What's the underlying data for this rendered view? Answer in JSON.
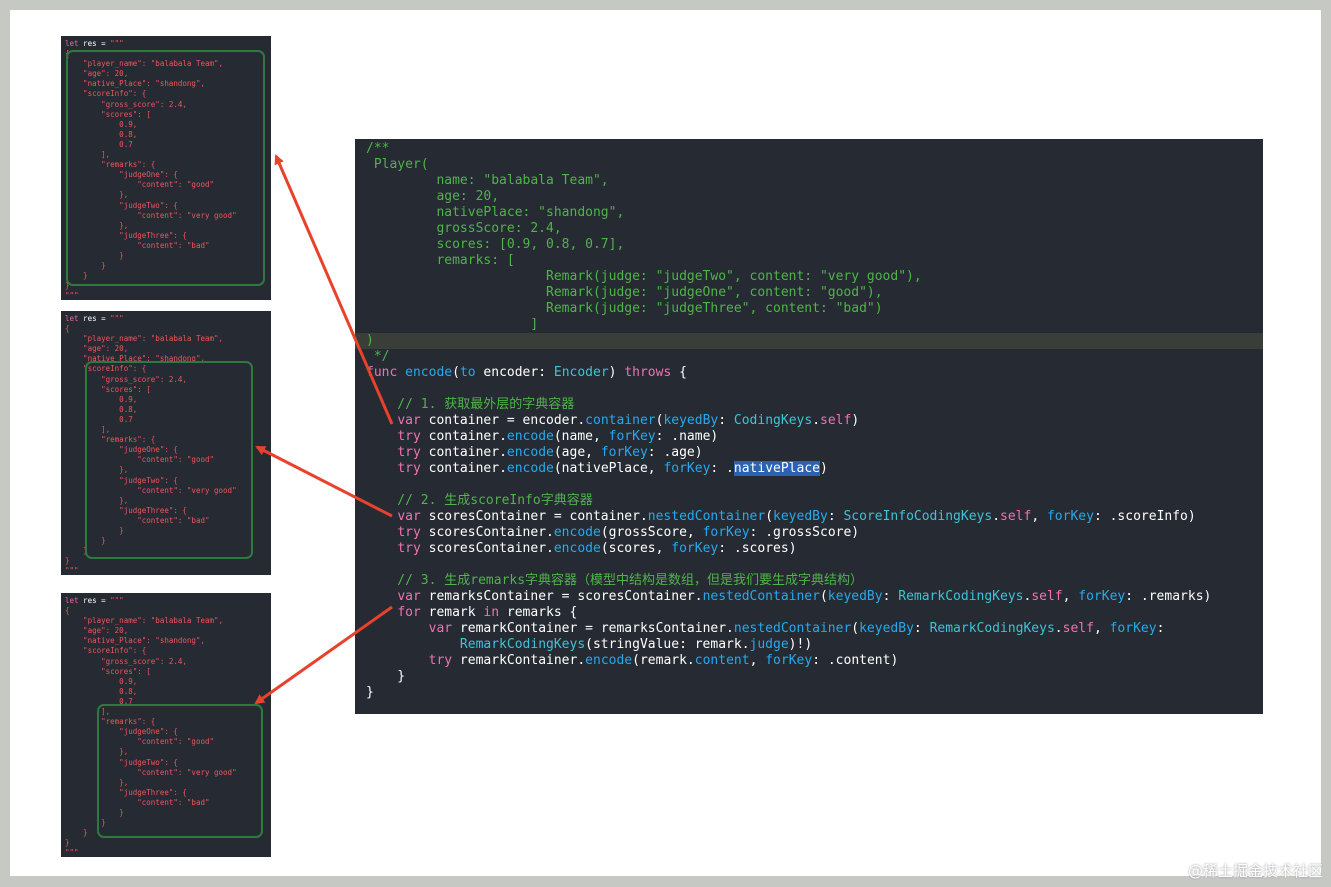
{
  "thumbnails": [
    {
      "lines": [
        "let res = \"\"\"",
        "{",
        "    \"player_name\": \"balabala Team\",",
        "    \"age\": 20,",
        "    \"native_Place\": \"shandong\",",
        "    \"scoreInfo\": {",
        "        \"gross_score\": 2.4,",
        "        \"scores\": [",
        "            0.9,",
        "            0.8,",
        "            0.7",
        "        ],",
        "        \"remarks\": {",
        "            \"judgeOne\": {",
        "                \"content\": \"good\"",
        "            },",
        "            \"judgeTwo\": {",
        "                \"content\": \"very good\"",
        "            },",
        "            \"judgeThree\": {",
        "                \"content\": \"bad\"",
        "            }",
        "        }",
        "    }",
        "}",
        "\"\"\""
      ]
    },
    {
      "lines": [
        "let res = \"\"\"",
        "{",
        "    \"player_name\": \"balabala Team\",",
        "    \"age\": 20,",
        "    \"native_Place\": \"shandong\",",
        "    \"scoreInfo\": {",
        "        \"gross_score\": 2.4,",
        "        \"scores\": [",
        "            0.9,",
        "            0.8,",
        "            0.7",
        "        ],",
        "        \"remarks\": {",
        "            \"judgeOne\": {",
        "                \"content\": \"good\"",
        "            },",
        "            \"judgeTwo\": {",
        "                \"content\": \"very good\"",
        "            },",
        "            \"judgeThree\": {",
        "                \"content\": \"bad\"",
        "            }",
        "        }",
        "    }",
        "}",
        "\"\"\""
      ]
    },
    {
      "lines": [
        "let res = \"\"\"",
        "{",
        "    \"player_name\": \"balabala Team\",",
        "    \"age\": 20,",
        "    \"native_Place\": \"shandong\",",
        "    \"scoreInfo\": {",
        "        \"gross_score\": 2.4,",
        "        \"scores\": [",
        "            0.9,",
        "            0.8,",
        "            0.7",
        "        ],",
        "        \"remarks\": {",
        "            \"judgeOne\": {",
        "                \"content\": \"good\"",
        "            },",
        "            \"judgeTwo\": {",
        "                \"content\": \"very good\"",
        "            },",
        "            \"judgeThree\": {",
        "                \"content\": \"bad\"",
        "            }",
        "        }",
        "    }",
        "}",
        "\"\"\""
      ]
    }
  ],
  "code": [
    [
      {
        "t": "/**",
        "c": "c"
      }
    ],
    [
      {
        "t": " Player(",
        "c": "c"
      }
    ],
    [
      {
        "t": "         name: \"balabala Team\",",
        "c": "c"
      }
    ],
    [
      {
        "t": "         age: 20,",
        "c": "c"
      }
    ],
    [
      {
        "t": "         nativePlace: \"shandong\",",
        "c": "c"
      }
    ],
    [
      {
        "t": "         grossScore: 2.4,",
        "c": "c"
      }
    ],
    [
      {
        "t": "         scores: [0.9, 0.8, 0.7],",
        "c": "c"
      }
    ],
    [
      {
        "t": "         remarks: [",
        "c": "c"
      }
    ],
    [
      {
        "t": "                       Remark(judge: \"judgeTwo\", content: \"very good\"),",
        "c": "c"
      }
    ],
    [
      {
        "t": "                       Remark(judge: \"judgeOne\", content: \"good\"),",
        "c": "c"
      }
    ],
    [
      {
        "t": "                       Remark(judge: \"judgeThree\", content: \"bad\")",
        "c": "c"
      }
    ],
    [
      {
        "t": "                     ]",
        "c": "c"
      }
    ],
    [
      {
        "t": ")",
        "c": "c"
      }
    ],
    [
      {
        "t": " */",
        "c": "c"
      }
    ],
    [
      {
        "t": "func",
        "c": "k"
      },
      {
        "t": " ",
        "c": "w"
      },
      {
        "t": "encode",
        "c": "f"
      },
      {
        "t": "(",
        "c": "w"
      },
      {
        "t": "to",
        "c": "f"
      },
      {
        "t": " encoder: ",
        "c": "w"
      },
      {
        "t": "Encoder",
        "c": "t"
      },
      {
        "t": ") ",
        "c": "w"
      },
      {
        "t": "throws",
        "c": "k"
      },
      {
        "t": " {",
        "c": "w"
      }
    ],
    [
      {
        "t": "",
        "c": "w"
      }
    ],
    [
      {
        "t": "    // 1. 获取最外层的字典容器",
        "c": "c"
      }
    ],
    [
      {
        "t": "    ",
        "c": "w"
      },
      {
        "t": "var",
        "c": "k"
      },
      {
        "t": " container = encoder.",
        "c": "w"
      },
      {
        "t": "container",
        "c": "f"
      },
      {
        "t": "(",
        "c": "w"
      },
      {
        "t": "keyedBy",
        "c": "f"
      },
      {
        "t": ": ",
        "c": "w"
      },
      {
        "t": "CodingKeys",
        "c": "t"
      },
      {
        "t": ".",
        "c": "w"
      },
      {
        "t": "self",
        "c": "k"
      },
      {
        "t": ")",
        "c": "w"
      }
    ],
    [
      {
        "t": "    ",
        "c": "w"
      },
      {
        "t": "try",
        "c": "k"
      },
      {
        "t": " container.",
        "c": "w"
      },
      {
        "t": "encode",
        "c": "f"
      },
      {
        "t": "(name, ",
        "c": "w"
      },
      {
        "t": "forKey",
        "c": "f"
      },
      {
        "t": ": .name)",
        "c": "w"
      }
    ],
    [
      {
        "t": "    ",
        "c": "w"
      },
      {
        "t": "try",
        "c": "k"
      },
      {
        "t": " container.",
        "c": "w"
      },
      {
        "t": "encode",
        "c": "f"
      },
      {
        "t": "(age, ",
        "c": "w"
      },
      {
        "t": "forKey",
        "c": "f"
      },
      {
        "t": ": .age)",
        "c": "w"
      }
    ],
    [
      {
        "t": "    ",
        "c": "w"
      },
      {
        "t": "try",
        "c": "k"
      },
      {
        "t": " container.",
        "c": "w"
      },
      {
        "t": "encode",
        "c": "f"
      },
      {
        "t": "(nativePlace, ",
        "c": "w"
      },
      {
        "t": "forKey",
        "c": "f"
      },
      {
        "t": ": .",
        "c": "w"
      },
      {
        "t": "nativePlace",
        "c": "w sel"
      },
      {
        "t": ")",
        "c": "w"
      }
    ],
    [
      {
        "t": "",
        "c": "w"
      }
    ],
    [
      {
        "t": "    // 2. 生成scoreInfo字典容器",
        "c": "c"
      }
    ],
    [
      {
        "t": "    ",
        "c": "w"
      },
      {
        "t": "var",
        "c": "k"
      },
      {
        "t": " scoresContainer = container.",
        "c": "w"
      },
      {
        "t": "nestedContainer",
        "c": "f"
      },
      {
        "t": "(",
        "c": "w"
      },
      {
        "t": "keyedBy",
        "c": "f"
      },
      {
        "t": ": ",
        "c": "w"
      },
      {
        "t": "ScoreInfoCodingKeys",
        "c": "t"
      },
      {
        "t": ".",
        "c": "w"
      },
      {
        "t": "self",
        "c": "k"
      },
      {
        "t": ", ",
        "c": "w"
      },
      {
        "t": "forKey",
        "c": "f"
      },
      {
        "t": ": .scoreInfo)",
        "c": "w"
      }
    ],
    [
      {
        "t": "    ",
        "c": "w"
      },
      {
        "t": "try",
        "c": "k"
      },
      {
        "t": " scoresContainer.",
        "c": "w"
      },
      {
        "t": "encode",
        "c": "f"
      },
      {
        "t": "(grossScore, ",
        "c": "w"
      },
      {
        "t": "forKey",
        "c": "f"
      },
      {
        "t": ": .grossScore)",
        "c": "w"
      }
    ],
    [
      {
        "t": "    ",
        "c": "w"
      },
      {
        "t": "try",
        "c": "k"
      },
      {
        "t": " scoresContainer.",
        "c": "w"
      },
      {
        "t": "encode",
        "c": "f"
      },
      {
        "t": "(scores, ",
        "c": "w"
      },
      {
        "t": "forKey",
        "c": "f"
      },
      {
        "t": ": .scores)",
        "c": "w"
      }
    ],
    [
      {
        "t": "",
        "c": "w"
      }
    ],
    [
      {
        "t": "    // 3. 生成remarks字典容器（模型中结构是数组，但是我们要生成字典结构）",
        "c": "c"
      }
    ],
    [
      {
        "t": "    ",
        "c": "w"
      },
      {
        "t": "var",
        "c": "k"
      },
      {
        "t": " remarksContainer = scoresContainer.",
        "c": "w"
      },
      {
        "t": "nestedContainer",
        "c": "f"
      },
      {
        "t": "(",
        "c": "w"
      },
      {
        "t": "keyedBy",
        "c": "f"
      },
      {
        "t": ": ",
        "c": "w"
      },
      {
        "t": "RemarkCodingKeys",
        "c": "t"
      },
      {
        "t": ".",
        "c": "w"
      },
      {
        "t": "self",
        "c": "k"
      },
      {
        "t": ", ",
        "c": "w"
      },
      {
        "t": "forKey",
        "c": "f"
      },
      {
        "t": ": .remarks)",
        "c": "w"
      }
    ],
    [
      {
        "t": "    ",
        "c": "w"
      },
      {
        "t": "for",
        "c": "k"
      },
      {
        "t": " remark ",
        "c": "w"
      },
      {
        "t": "in",
        "c": "k"
      },
      {
        "t": " remarks {",
        "c": "w"
      }
    ],
    [
      {
        "t": "        ",
        "c": "w"
      },
      {
        "t": "var",
        "c": "k"
      },
      {
        "t": " remarkContainer = remarksContainer.",
        "c": "w"
      },
      {
        "t": "nestedContainer",
        "c": "f"
      },
      {
        "t": "(",
        "c": "w"
      },
      {
        "t": "keyedBy",
        "c": "f"
      },
      {
        "t": ": ",
        "c": "w"
      },
      {
        "t": "RemarkCodingKeys",
        "c": "t"
      },
      {
        "t": ".",
        "c": "w"
      },
      {
        "t": "self",
        "c": "k"
      },
      {
        "t": ", ",
        "c": "w"
      },
      {
        "t": "forKey",
        "c": "f"
      },
      {
        "t": ":",
        "c": "w"
      }
    ],
    [
      {
        "t": "            ",
        "c": "w"
      },
      {
        "t": "RemarkCodingKeys",
        "c": "t"
      },
      {
        "t": "(stringValue: remark.",
        "c": "w"
      },
      {
        "t": "judge",
        "c": "f"
      },
      {
        "t": ")!)",
        "c": "w"
      }
    ],
    [
      {
        "t": "        ",
        "c": "w"
      },
      {
        "t": "try",
        "c": "k"
      },
      {
        "t": " remarkContainer.",
        "c": "w"
      },
      {
        "t": "encode",
        "c": "f"
      },
      {
        "t": "(remark.",
        "c": "w"
      },
      {
        "t": "content",
        "c": "f"
      },
      {
        "t": ", ",
        "c": "w"
      },
      {
        "t": "forKey",
        "c": "f"
      },
      {
        "t": ": .content)",
        "c": "w"
      }
    ],
    [
      {
        "t": "    }",
        "c": "w"
      }
    ],
    [
      {
        "t": "}",
        "c": "w"
      }
    ]
  ],
  "watermark": "@稀土掘金技术社区",
  "colors": {
    "background": "#c6c9c3",
    "editor": "#262a33",
    "comment": "#4fb449",
    "keyword": "#ee73b0",
    "type": "#3fc3d6",
    "function": "#28a9ec",
    "json_text": "#f0555c",
    "highlight_box": "#2e7a3e",
    "arrow": "#e8412c",
    "selection": "#2a63b2"
  }
}
